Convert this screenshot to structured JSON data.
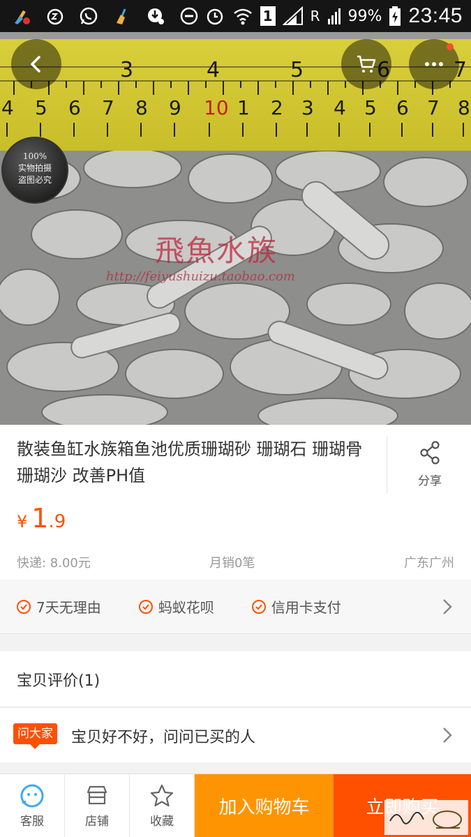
{
  "statusbar": {
    "battery": "99%",
    "time": "23:45",
    "sim": "1",
    "roaming": "R"
  },
  "hero": {
    "stamp_lines": [
      "100%",
      "实物拍摄",
      "盗图必究"
    ],
    "watermark_name": "飛魚水族",
    "watermark_url": "http://feiyushuizu.taobao.com",
    "ruler_top_numbers": [
      "3",
      "4",
      "5",
      "6",
      "7"
    ],
    "ruler_bottom_numbers": [
      "4",
      "5",
      "6",
      "7",
      "8",
      "9",
      "10",
      "1",
      "2",
      "3",
      "4",
      "5",
      "6",
      "7",
      "8"
    ]
  },
  "product": {
    "title": "散装鱼缸水族箱鱼池优质珊瑚砂 珊瑚石 珊瑚骨 珊瑚沙  改善PH值",
    "share_label": "分享",
    "price_symbol": "¥",
    "price_int": "1",
    "price_dec": ".9",
    "shipping": "快递: 8.00元",
    "monthly_sales": "月销0笔",
    "location": "广东广州"
  },
  "guarantees": [
    {
      "label": "7天无理由"
    },
    {
      "label": "蚂蚁花呗"
    },
    {
      "label": "信用卡支付"
    }
  ],
  "reviews": {
    "title": "宝贝评价(1)"
  },
  "ask": {
    "badge": "问大家",
    "text": "宝贝好不好，问问已买的人"
  },
  "bottombar": {
    "service": "客服",
    "shop": "店铺",
    "favorite": "收藏",
    "add_to_cart": "加入购物车",
    "buy_now": "立即购买"
  },
  "colors": {
    "accent": "#ff5000",
    "cart_button": "#ff9402",
    "service_icon": "#3da9f5"
  }
}
